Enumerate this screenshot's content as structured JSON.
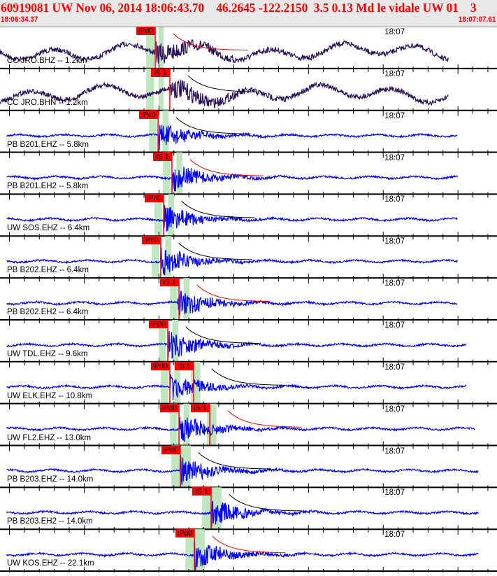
{
  "header": {
    "title": "60919081 UW Nov 06, 2014 18:06:43.70    46.2645 -122.2150  3.5 0.13 Md le vidale UW 01    3",
    "start_time": "18:06:34.37",
    "end_time": "18:07:07.61"
  },
  "time_axis": {
    "duration_s": 33.24,
    "minute_mark_s": 25.63,
    "minute_label": "18:07"
  },
  "colors": {
    "velocity_trace": "#2a1058",
    "trace": "#0000ff",
    "pick": "#ff0000",
    "window": "#bfe6bf"
  },
  "traces": [
    {
      "label": "CC JRO.BHZ -- 1.2km",
      "color": "#2a1058",
      "picks": [
        {
          "label": "iPd0",
          "t": 10.38
        }
      ],
      "onset": 10.4,
      "end": 30.0
    },
    {
      "label": "CC JRO.BHN -- 1.2km",
      "color": "#2a1058",
      "picks": [
        {
          "label": "iS 1",
          "t": 11.36
        }
      ],
      "onset": 11.4,
      "end": 30.0
    },
    {
      "label": "PB B201.EHZ -- 5.8km",
      "color": "#0000ff",
      "picks": [
        {
          "label": "iPc0",
          "t": 10.57
        }
      ],
      "onset": 10.6,
      "end": 30.6
    },
    {
      "label": "PB B201.EH2 -- 5.8km",
      "color": "#0000ff",
      "picks": [
        {
          "label": "iS 1",
          "t": 11.5
        }
      ],
      "onset": 11.5,
      "end": 30.6
    },
    {
      "label": "UW SOS.EHZ -- 6.4km",
      "color": "#0000ff",
      "picks": [
        {
          "label": "iPc0",
          "t": 10.94
        }
      ],
      "onset": 10.95,
      "end": 30.6
    },
    {
      "label": "PB B202.EHZ -- 6.4km",
      "color": "#0000ff",
      "picks": [
        {
          "label": "iPc0",
          "t": 10.75
        }
      ],
      "onset": 10.75,
      "end": 30.6
    },
    {
      "label": "PB B202.EH2 -- 6.4km",
      "color": "#0000ff",
      "picks": [
        {
          "label": "iS 1",
          "t": 11.97
        }
      ],
      "onset": 11.9,
      "end": 30.6
    },
    {
      "label": "UW TDL.EHZ -- 9.6km",
      "color": "#0000ff",
      "picks": [
        {
          "label": "iPd0",
          "t": 11.22
        }
      ],
      "onset": 11.22,
      "end": 31.2
    },
    {
      "label": "UW ELK.EHZ -- 10.8km",
      "color": "#0000ff",
      "picks": [
        {
          "label": "iPd0",
          "t": 11.36
        },
        {
          "label": "iS 1",
          "t": 12.95
        }
      ],
      "onset": 11.36,
      "end": 31.2
    },
    {
      "label": "UW FL2.EHZ -- 13.0km",
      "color": "#0000ff",
      "picks": [
        {
          "label": "iPd0",
          "t": 11.97
        },
        {
          "label": "iS 1",
          "t": 14.03
        }
      ],
      "onset": 12.0,
      "end": 31.8
    },
    {
      "label": "PB B203.EHZ -- 14.0km",
      "color": "#0000ff",
      "picks": [
        {
          "label": "iPd0",
          "t": 12.06
        }
      ],
      "onset": 12.06,
      "end": 32.0
    },
    {
      "label": "PB B203.EH2 -- 14.0km",
      "color": "#0000ff",
      "picks": [
        {
          "label": "iS 1",
          "t": 14.12
        }
      ],
      "onset": 14.1,
      "end": 32.0
    },
    {
      "label": "UW KOS.EHZ -- 22.1km",
      "color": "#0000ff",
      "picks": [
        {
          "label": "iPd0",
          "t": 13.0
        }
      ],
      "onset": 13.0,
      "end": 32.0
    }
  ]
}
